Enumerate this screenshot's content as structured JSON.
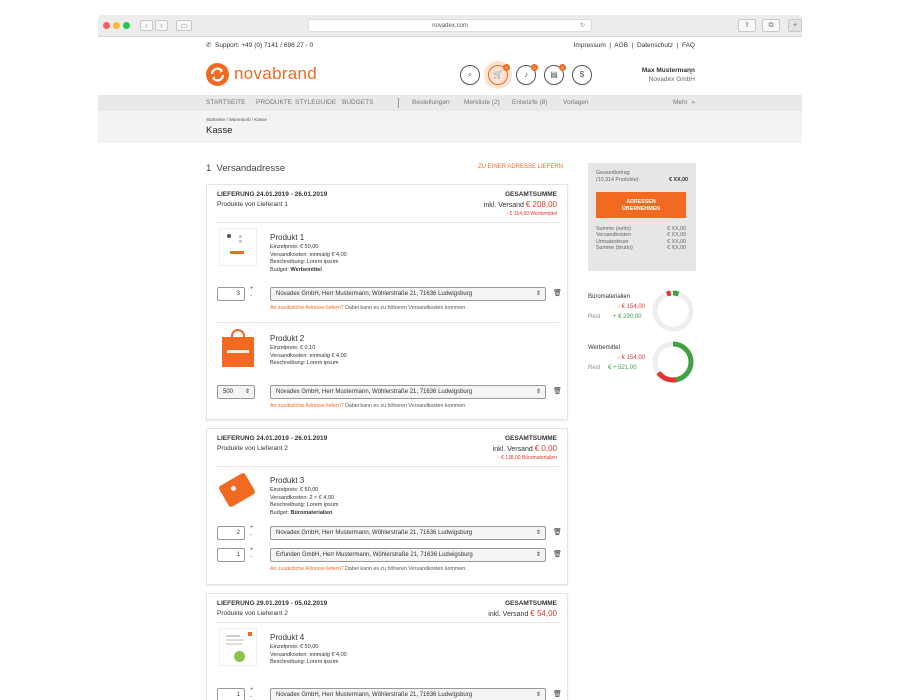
{
  "browser": {
    "url": "novadex.com"
  },
  "topbar": {
    "support": "Support: +49 (0) 7141 / 696 27 - 0",
    "links": "Impressum  |  AGB  |  Datenschutz  |  FAQ"
  },
  "header": {
    "brand": "novabrand",
    "user_name": "Max Mustermann",
    "user_company": "Novadex GmbH",
    "badges": {
      "cart": "0",
      "bell": "0",
      "calendar": "0"
    }
  },
  "nav": {
    "items": [
      "STARTSEITE",
      "PRODUKTE",
      "STYLEGUIDE",
      "BUDGETS"
    ],
    "secondary": [
      "Bestellungen",
      "Merkliste (2)",
      "Entwürfe (8)",
      "Vorlagen"
    ],
    "more": "Mehr  »"
  },
  "breadcrumb": "Startseite / Warenkorb / Kasse",
  "page_title": "Kasse",
  "section": {
    "title": "1  Versandadresse",
    "action": "ZU EINER ADRESSE LIEFERN"
  },
  "labels": {
    "total_header": "GESAMTSUMME",
    "extra_address_link": "An zusätzliche Adresse liefern?",
    "extra_address_note": " Dabei kann es zu höheren Versandkosten kommen."
  },
  "deliveries": [
    {
      "date": "LIEFERUNG 24.01.2019 - 26.01.2019",
      "supplier": "Produkte von Lieferant 1",
      "incl": "inkl. Versand ",
      "total": "€ 208,00",
      "budget_note": "- € 154,00 Werbemittel",
      "products": [
        {
          "name": "Produkt 1",
          "lines": [
            "Einzelpreis: € 50,00",
            "Versandkosten: einmalig € 4,00",
            "Beschreibung: Lorem ipsum"
          ],
          "budget_label": "Budget: ",
          "budget": "Werbemittel",
          "qty": "3",
          "address": "Novadex GmbH, Herr Mustermann, Wöhlerstraße 21, 71636 Ludwigsburg"
        },
        {
          "name": "Produkt 2",
          "lines": [
            "Einzelpreis: € 0,10",
            "Versandkosten: einmalig € 4,00",
            "Beschreibung: Lorem ipsum"
          ],
          "qty": "500",
          "address": "Novadex GmbH, Herr Mustermann, Wöhlerstraße 21, 71636 Ludwigsburg"
        }
      ]
    },
    {
      "date": "LIEFERUNG 24.01.2019 - 26.01.2019",
      "supplier": "Produkte von Lieferant 2",
      "incl": "inkl. Versand ",
      "total": "€ 0,00",
      "budget_note": "- € 138,00 Büromaterialien",
      "products": [
        {
          "name": "Produkt 3",
          "lines": [
            "Einzelpreis: € 50,00",
            "Versandkosten: 2 × € 4,00",
            "Beschreibung: Lorem ipsum"
          ],
          "budget_label": "Budget: ",
          "budget": "Büromaterialien",
          "qty": "2",
          "qty2": "1",
          "address": "Novadex GmbH, Herr Mustermann, Wöhlerstraße 21, 71636 Ludwigsburg",
          "address2": "Erfunden GmbH, Herr Mustermann, Wöhlerstraße 21, 71636 Ludwigsburg"
        }
      ]
    },
    {
      "date": "LIEFERUNG 29.01.2019 - 05.02.2019",
      "supplier": "Produkte von Lieferant 2",
      "incl": "inkl. Versand ",
      "total": "€ 54,00",
      "products": [
        {
          "name": "Produkt 4",
          "lines": [
            "Einzelpreis: € 50,00",
            "Versandkosten: einmalig € 4,00",
            "Beschreibung: Lorem ipsum"
          ],
          "qty": "1",
          "address": "Novadex GmbH, Herr Mustermann, Wöhlerstraße 21, 71636 Ludwigsburg"
        }
      ]
    }
  ],
  "summary": {
    "label": "Gesamtbetrag",
    "count": "(10.314 Produkte):",
    "amount": "€ XX,00",
    "button": "ADRESSEN ÜBERNEHMEN",
    "rows": [
      {
        "k": "Summe (netto)",
        "v": "€ XX,00"
      },
      {
        "k": "Versandkosten",
        "v": "€ XX,00"
      },
      {
        "k": "Umsatzsteuer",
        "v": "€ XX,00"
      },
      {
        "k": "Summe (brutto)",
        "v": "€ XX,00"
      }
    ]
  },
  "budgets": [
    {
      "name": "Büromaterialien",
      "used": "- € 154,00",
      "rest_label": "Rest",
      "rest": "+ € 290,00",
      "used_fraction": 0.05
    },
    {
      "name": "Werbemittel",
      "used": "- € 154,00",
      "rest_label": "Rest",
      "rest": "€ + 521,00",
      "used_fraction": 0.48
    }
  ],
  "colors": {
    "accent": "#f26a21",
    "red": "#e3342f",
    "green": "#43a047"
  }
}
